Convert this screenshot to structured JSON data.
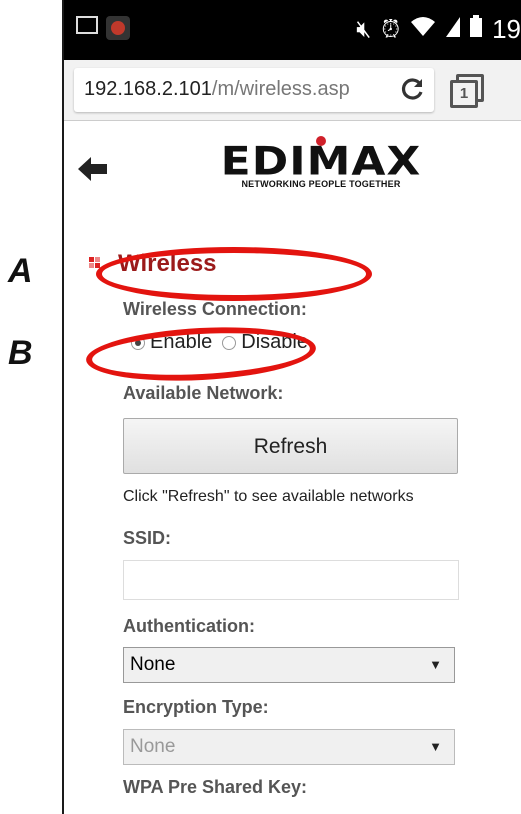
{
  "statusbar": {
    "time": "19",
    "icons": [
      "image-icon",
      "app-icon",
      "mute-icon",
      "alarm-icon",
      "wifi-icon",
      "signal-icon",
      "battery-icon"
    ]
  },
  "browser": {
    "url_host": "192.168.2.101",
    "url_path": "/m/wireless.asp",
    "reload_glyph": "C",
    "tab_count": "1"
  },
  "logo": {
    "word": "EDIMAX",
    "tagline": "NETWORKING PEOPLE TOGETHER"
  },
  "section": {
    "title": "Wireless"
  },
  "form": {
    "wireless_connection_label": "Wireless Connection:",
    "enable_label": "Enable",
    "disable_label": "Disable",
    "enable_selected": true,
    "available_network_label": "Available Network:",
    "refresh_label": "Refresh",
    "refresh_hint": "Click \"Refresh\" to see available networks",
    "ssid_label": "SSID:",
    "ssid_value": "",
    "authentication_label": "Authentication:",
    "authentication_value": "None",
    "encryption_label": "Encryption Type:",
    "encryption_value": "None",
    "wpa_label": "WPA Pre Shared Key:"
  },
  "annotations": {
    "a_label": "A",
    "b_label": "B",
    "ring_color": "#e3140f"
  },
  "colors": {
    "section_title": "#9b1a1a",
    "label_gray": "#555555",
    "logo_dot": "#d0202a"
  }
}
